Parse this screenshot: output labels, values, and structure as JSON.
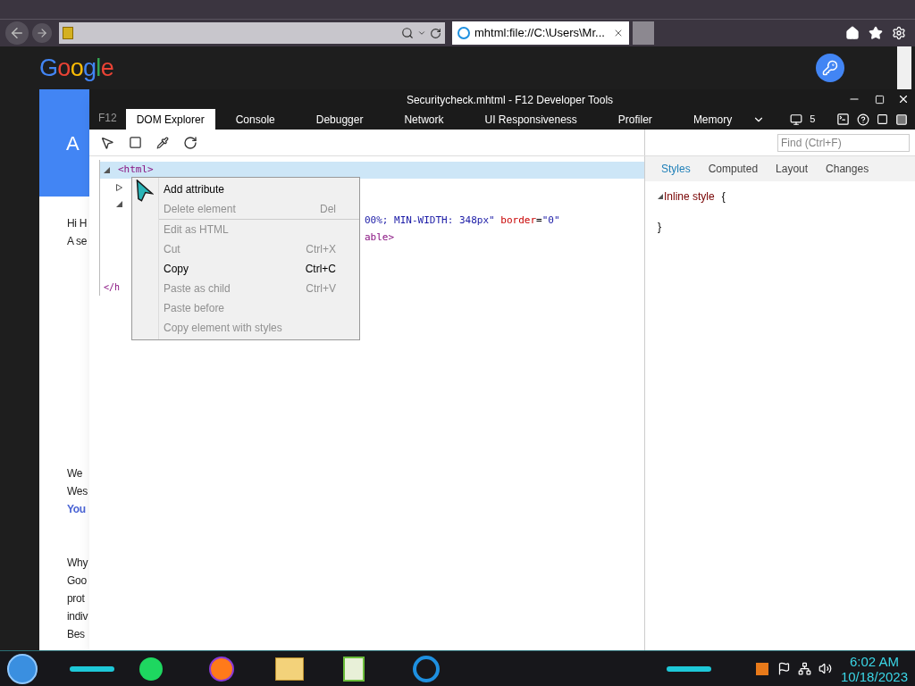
{
  "browser": {
    "tab_title": "mhtml:file://C:\\Users\\Mr..."
  },
  "page": {
    "logo": [
      {
        "text": "G",
        "color": "#4285f4"
      },
      {
        "text": "o",
        "color": "#ea4335"
      },
      {
        "text": "o",
        "color": "#fbbc05"
      },
      {
        "text": "g",
        "color": "#4285f4"
      },
      {
        "text": "l",
        "color": "#34a853"
      },
      {
        "text": "e",
        "color": "#ea4335"
      }
    ],
    "header_letter": "A",
    "lines_top": [
      "Hi H",
      "A se"
    ],
    "lines_mid": [
      {
        "text": "We",
        "kind": "plain"
      },
      {
        "text": "Wes",
        "kind": "plain"
      },
      {
        "text": "You",
        "kind": "link"
      }
    ],
    "lines_bottom": [
      "Why",
      "Goo",
      "prot",
      "indiv",
      "Bes"
    ]
  },
  "devtools": {
    "title": "Securitycheck.mhtml - F12 Developer Tools",
    "f12": "F12",
    "tabs": [
      {
        "label": "DOM Explorer",
        "selected": true
      },
      {
        "label": "Console",
        "selected": false
      },
      {
        "label": "Debugger",
        "selected": false
      },
      {
        "label": "Network",
        "selected": false
      },
      {
        "label": "UI Responsiveness",
        "selected": false
      },
      {
        "label": "Profiler",
        "selected": false
      },
      {
        "label": "Memory",
        "selected": false
      }
    ],
    "emulation_count": "5",
    "find_placeholder": "Find (Ctrl+F)",
    "dom_tree": [
      {
        "expanded": true,
        "selected": true,
        "parts": [
          {
            "kind": "tag",
            "text": "<html>"
          }
        ],
        "closing": "</h",
        "children": [
          {
            "expanded": false
          },
          {
            "expanded": true,
            "children": [
              {
                "parts": [
                  {
                    "kind": "value",
                    "text": "00%; MIN-WIDTH: 348px\""
                  },
                  {
                    "kind": "attr",
                    "text": " border"
                  },
                  {
                    "kind": "punct",
                    "text": "="
                  },
                  {
                    "kind": "value",
                    "text": "\"0\""
                  }
                ]
              },
              {
                "parts": [
                  {
                    "kind": "tag",
                    "text": "able>"
                  }
                ]
              }
            ]
          }
        ]
      }
    ],
    "context_menu": [
      {
        "label": "Add attribute",
        "disabled": false
      },
      {
        "label": "Delete element",
        "shortcut": "Del",
        "disabled": true,
        "separator_after": true
      },
      {
        "label": "Edit as HTML",
        "disabled": true
      },
      {
        "label": "Cut",
        "shortcut": "Ctrl+X",
        "disabled": true
      },
      {
        "label": "Copy",
        "shortcut": "Ctrl+C",
        "disabled": false
      },
      {
        "label": "Paste as child",
        "shortcut": "Ctrl+V",
        "disabled": true
      },
      {
        "label": "Paste before",
        "disabled": true
      },
      {
        "label": "Copy element with styles",
        "disabled": true
      }
    ],
    "style_tabs": [
      {
        "label": "Styles",
        "selected": true
      },
      {
        "label": "Computed",
        "selected": false
      },
      {
        "label": "Layout",
        "selected": false
      },
      {
        "label": "Changes",
        "selected": false
      }
    ],
    "style_rule": {
      "name": "Inline style",
      "open": "{",
      "close": "}"
    }
  },
  "taskbar": {
    "time": "6:02 AM",
    "date": "10/18/2023"
  }
}
